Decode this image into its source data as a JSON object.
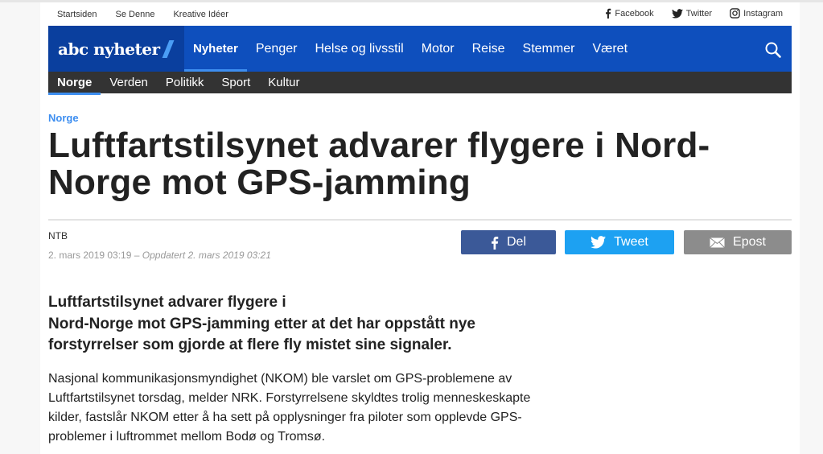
{
  "toplinks": {
    "left": [
      "Startsiden",
      "Se Denne",
      "Kreative Idéer"
    ],
    "social": [
      {
        "icon": "facebook-icon",
        "label": "Facebook"
      },
      {
        "icon": "twitter-icon",
        "label": "Twitter"
      },
      {
        "icon": "instagram-icon",
        "label": "Instagram"
      }
    ]
  },
  "brand": {
    "logo_text": "abc nyheter",
    "primary_color": "#0e4fbd",
    "logo_bg_color": "#0a3f9e",
    "accent_color": "#3d8ef0"
  },
  "mainnav": {
    "items": [
      "Nyheter",
      "Penger",
      "Helse og livsstil",
      "Motor",
      "Reise",
      "Stemmer",
      "Været"
    ],
    "active": "Nyheter",
    "search_icon": "search-icon"
  },
  "subnav": {
    "items": [
      "Norge",
      "Verden",
      "Politikk",
      "Sport",
      "Kultur"
    ],
    "active": "Norge"
  },
  "article": {
    "category": "Norge",
    "headline": "Luftfartstilsynet advarer flygere i Nord-Norge mot GPS-jamming",
    "byline": "NTB",
    "published": "2. mars 2019 03:19",
    "separator": "–",
    "updated": "Oppdatert 2. mars 2019 03:21",
    "lead_line1": "Luftfartstilsynet advarer flygere i",
    "lead_line2": "Nord-Norge mot GPS-jamming etter at det har oppstått nye forstyrrelser som gjorde at flere fly mistet sine signaler.",
    "body": "Nasjonal kommunikasjonsmyndighet (NKOM) ble varslet om GPS-problemene av Luftfartstilsynet torsdag, melder NRK. Forstyrrelsene skyldtes trolig menneskeskapte kilder, fastslår NKOM etter å ha sett på opplysninger fra piloter som opplevde GPS-problemer i luftrommet mellom Bodø og Tromsø."
  },
  "share": {
    "facebook": {
      "label": "Del",
      "icon": "facebook-icon",
      "color": "#3b5998"
    },
    "twitter": {
      "label": "Tweet",
      "icon": "twitter-icon",
      "color": "#1da1f2"
    },
    "email": {
      "label": "Epost",
      "icon": "envelope-icon",
      "color": "#8c8c8c"
    }
  }
}
